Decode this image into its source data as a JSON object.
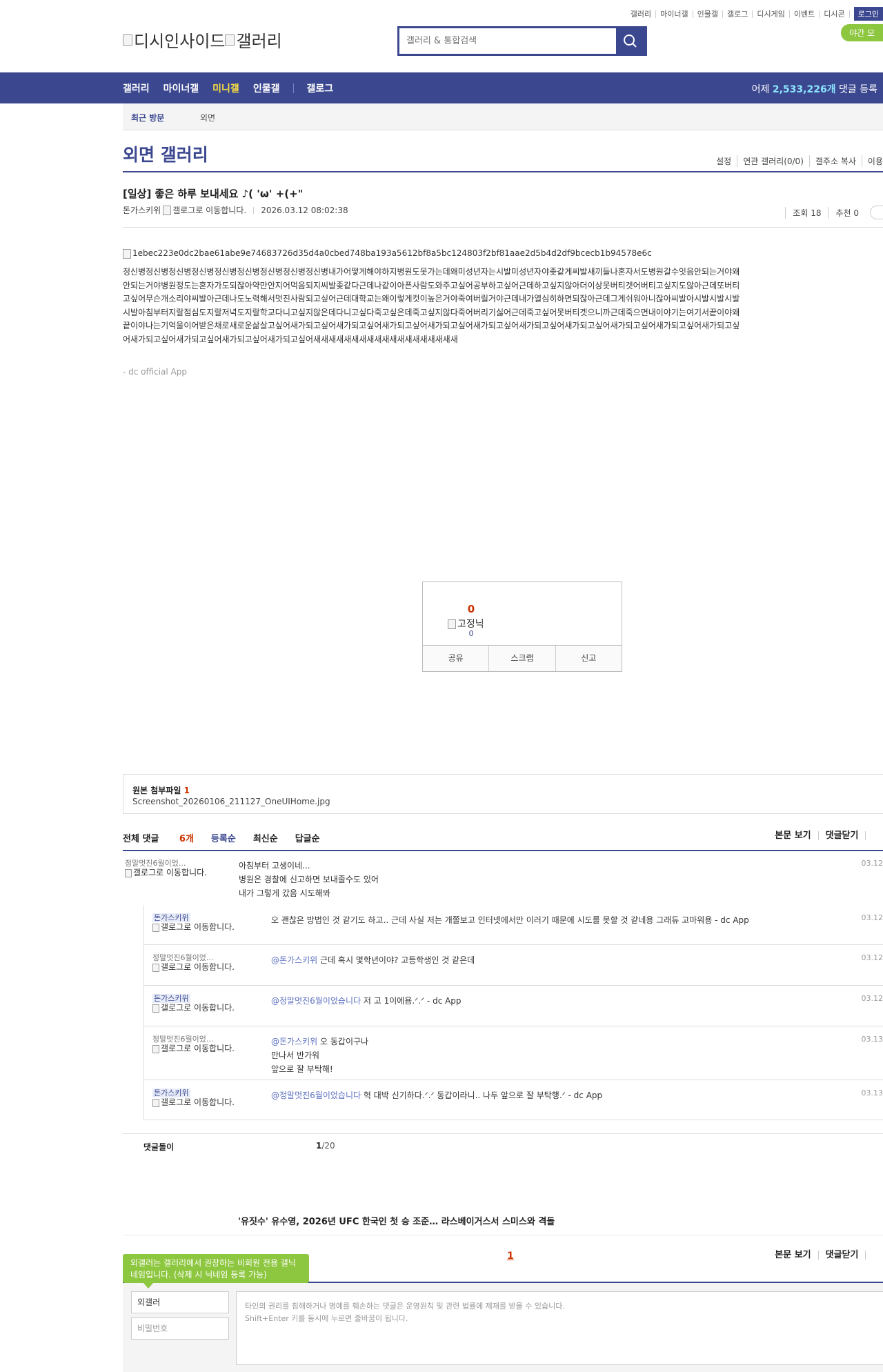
{
  "util_nav": [
    "갤러리",
    "마이너갤",
    "인물갤",
    "갤로그",
    "디시게임",
    "이벤트",
    "디시콘"
  ],
  "login_label": "로그인",
  "night_mode_label": "야간 모",
  "logo_text_1": "디시인사이드",
  "logo_text_2": "갤러리",
  "search_placeholder": "갤러리 & 통합검색",
  "gnb": {
    "items": [
      "갤러리",
      "마이너갤",
      "미니갤",
      "인물갤",
      "갤로그"
    ],
    "stat_prefix": "어제 ",
    "stat_count": "2,533,226개",
    "stat_suffix": " 댓글 등록"
  },
  "recent_visit": {
    "label": "최근 방문",
    "value": "외면"
  },
  "gallery_title": "외면 갤러리",
  "gallery_options": [
    "설정",
    "연관 갤러리(0/0)",
    "갤주소 복사",
    "이용"
  ],
  "post": {
    "title": "[일상] 좋은 하루 보내세요 ♪( 'ω' +(+\"",
    "author": "돈가스키위",
    "author_alt": "갤로그로 이동합니다.",
    "date": "2026.03.12 08:02:38",
    "views": "조회 18",
    "recommend": "추천 0",
    "image_name": "1ebec223e0dc2bae61abe9e74683726d35d4a0cbed748ba193a5612bf8a5bc124803f2bf81aae2d5b4d2df9bcecb1b94578e6c",
    "body": "정신병정신병정신병정신병정신병정신병정신병정신병정신병내가어떻게해야하지병원도못가는데왜미성년자는시발미성년자야좆같게씨발새끼들나혼자서도병원갈수잇음안되는거야왜안되는거야병원정도는혼자가도되잖아약만안지어먹음되지씨발좆같다근데나같이아픈사람도와주고싶어공부하고싶어근데하고싶지않아더이상못버티겟어버티고싶지도않아근데또버티고싶어무슨개소리야씨발아근데나도노력해서멋진사람되고싶어근데대학교는왜이렇게컷이높은거야죽여버릴거야근데내가열심히하면되잖아근데그게쉬워아니잖아씨발아시발시발시발시발아침부터지랄점심도지랄저녁도지랄학교다니고싶지않은데다니고싶다죽고싶은데죽고싶지않다죽어버리기싫어근데죽고싶어못버티겟으니까근데죽으면내이야기는여기서끝이야왜끝이야나는기억울이어받은채로새로운삶살고싶어새가되고싶어새가되고싶어새가되고싶어새가되고싶어새가되고싶어새가되고싶어새가되고싶어새가되고싶어새가되고싶어새가되고싶어새가되고싶어새가되고싶어새가되고싶어새가되고싶어새새새새새새새새새새새새새새새새새새새",
    "signature": "- dc official App"
  },
  "recommend_box": {
    "count": "0",
    "nick": "고정닉",
    "sub_count": "0",
    "buttons": [
      "공유",
      "스크랩",
      "신고"
    ]
  },
  "attachment": {
    "label": "원본 첨부파일 ",
    "count": "1",
    "file": "Screenshot_20260106_211127_OneUIHome.jpg"
  },
  "comments_bar": {
    "total_label": "전체 댓글 ",
    "total_count": "6개",
    "sorts": [
      "등록순",
      "최신순",
      "답글순"
    ],
    "right": [
      "본문 보기",
      "댓글닫기"
    ]
  },
  "comments": [
    {
      "nick": "정말멋진6월이었...",
      "move": "갤로그로 이동합니다.",
      "text_lines": [
        "아침부터 고생이네...",
        "병원은 경찰에 신고하면 보내줄수도 있어",
        "내가 그렇게 갔음 시도해봐"
      ],
      "date": "03.12"
    }
  ],
  "replies": [
    {
      "nick": "돈가스키위",
      "fixed": true,
      "move": "갤로그로 이동합니다.",
      "mention": "",
      "text": "오 괜찮은 방법인 것 같기도 하고.. 근데 사실 저는 개쫄보고 인터넷에서만 이러기 때문에 시도를 못할 것 같네용 그래듀 고마워용 - dc App",
      "date": "03.12"
    },
    {
      "nick": "정말멋진6월이었...",
      "fixed": false,
      "move": "갤로그로 이동합니다.",
      "mention": "@돈가스키위",
      "text": " 근데 혹시 몇학년이야? 고등학생인 것 같은데",
      "date": "03.12"
    },
    {
      "nick": "돈가스키위",
      "fixed": true,
      "move": "갤로그로 이동합니다.",
      "mention": "@정말멋진6월이었습니다",
      "text": " 저 고 1이에욤.ᐟ.ᐟ - dc App",
      "date": "03.12"
    },
    {
      "nick": "정말멋진6월이었...",
      "fixed": false,
      "move": "갤로그로 이동합니다.",
      "mention": "@돈가스키위",
      "text": " 오 동갑이구나\n만나서 반가워\n앞으로 잘 부탁해!",
      "date": "03.13"
    },
    {
      "nick": "돈가스키위",
      "fixed": true,
      "move": "갤로그로 이동합니다.",
      "mention": "@정말멋진6월이었습니다",
      "text": " 헉 대박 신기하다.ᐟ.ᐟ 동갑이라니.. 나두 앞으로 잘 부탁행.ᐟ - dc App",
      "date": "03.13"
    }
  ],
  "reply_counter": {
    "label": "댓글돌이",
    "current": "1",
    "total": "/20"
  },
  "news_headline": "'유짓수' 유수영, 2026년 UFC 한국인 첫 승 조준… 라스베이거스서 스미스와 격돌",
  "pager_current": "1",
  "bottom_bar": [
    "본문 보기",
    "댓글닫기"
  ],
  "write": {
    "tip": "외갤러는 갤러리에서 권장하는 비회원 전용 갤닉네임입니다. (삭제 시 닉네임 등록 가능)",
    "nick_value": "외갤러",
    "password_placeholder": "비밀번호",
    "textarea_placeholder_1": "타인의 권리를 침해하거나 명예를 훼손하는 댓글은 운영원칙 및 관련 법률에 제재를 받을 수 있습니다.",
    "textarea_placeholder_2": "Shift+Enter 키를 동시에 누르면 줄바꿈이 됩니다."
  },
  "colors": {
    "brand": "#3b4890",
    "highlight": "#ffe23f",
    "accent_green": "#8dc63f",
    "count_red": "#cc3300"
  }
}
